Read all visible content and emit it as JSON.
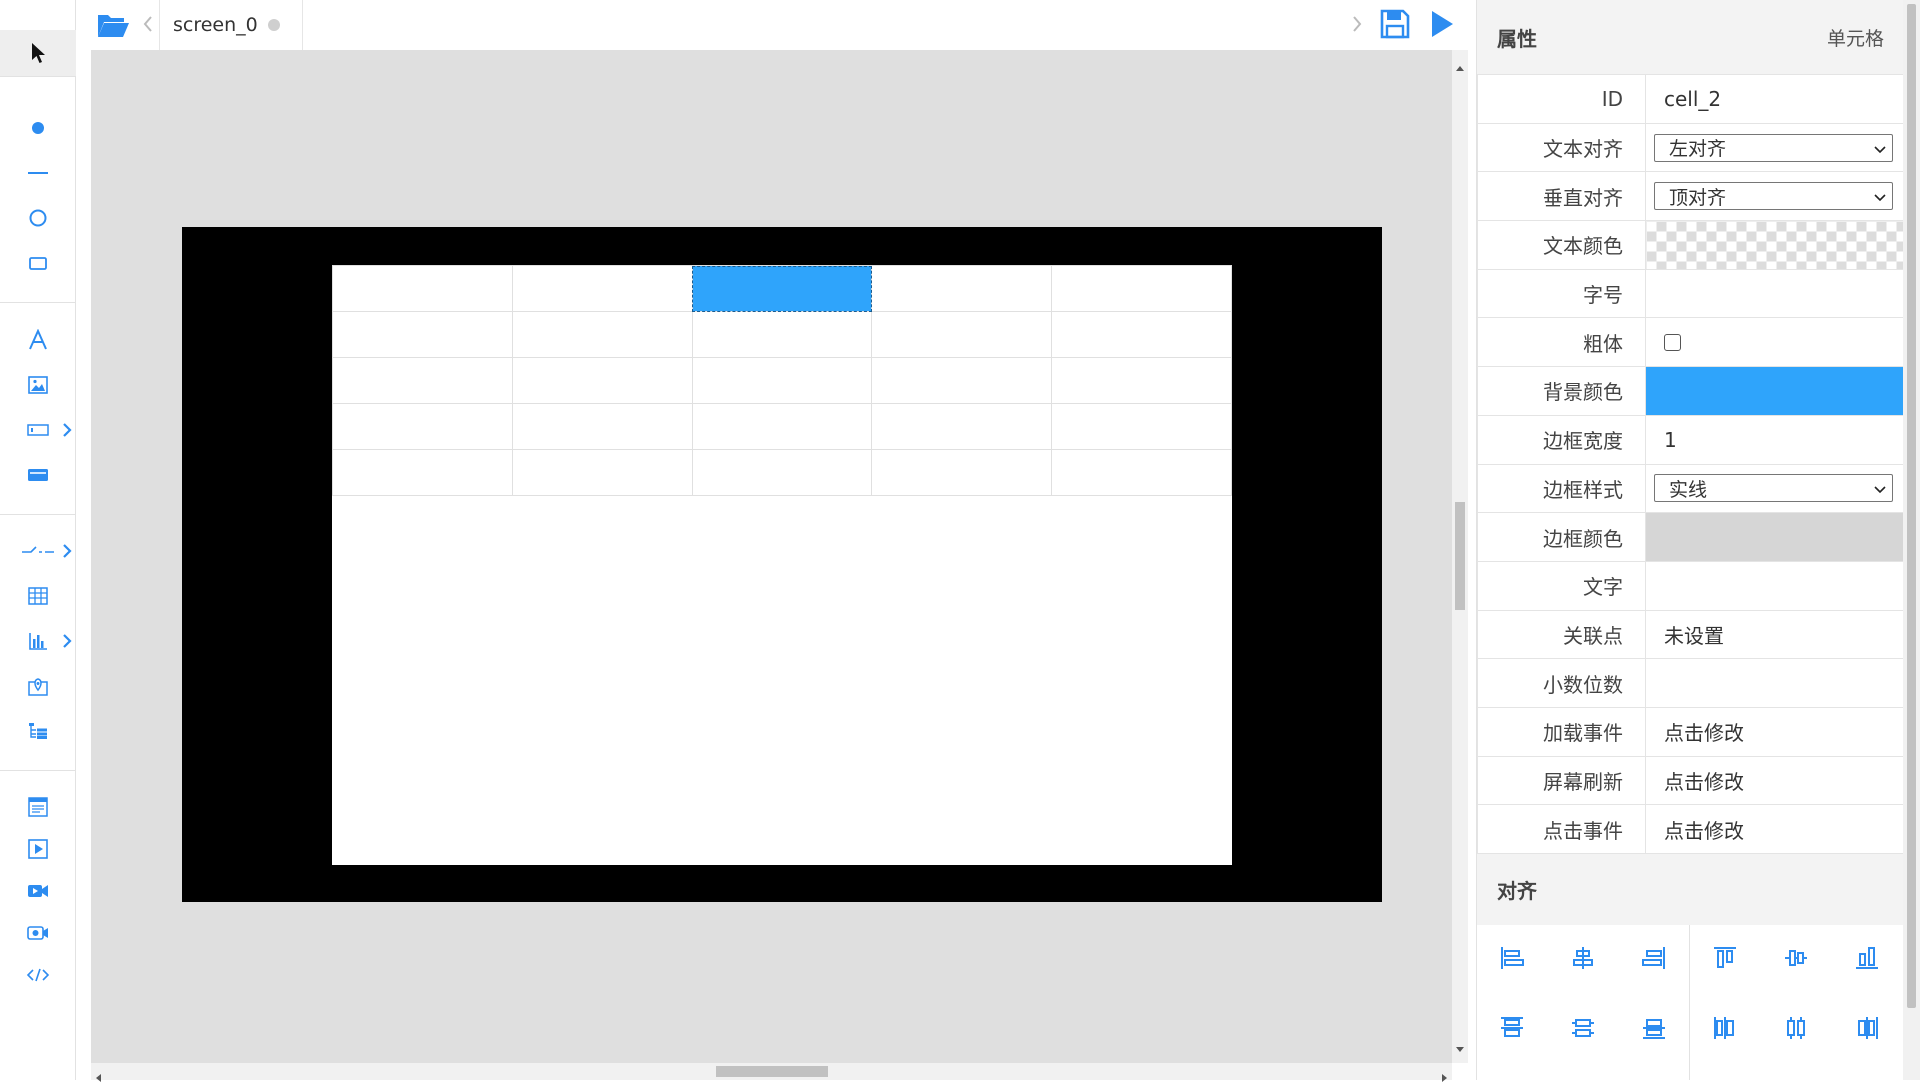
{
  "tab": {
    "name": "screen_0"
  },
  "properties": {
    "title": "属性",
    "object_type": "单元格",
    "rows": {
      "id": {
        "label": "ID",
        "value": "cell_2"
      },
      "text_align": {
        "label": "文本对齐",
        "value": "左对齐"
      },
      "vertical_align": {
        "label": "垂直对齐",
        "value": "顶对齐"
      },
      "text_color": {
        "label": "文本颜色"
      },
      "font_size": {
        "label": "字号",
        "value": ""
      },
      "bold": {
        "label": "粗体",
        "checked": false
      },
      "background_color": {
        "label": "背景颜色",
        "color": "#2fa4fb"
      },
      "border_width": {
        "label": "边框宽度",
        "value": "1"
      },
      "border_style": {
        "label": "边框样式",
        "value": "实线"
      },
      "border_color": {
        "label": "边框颜色",
        "color": "#d6d6d6"
      },
      "text": {
        "label": "文字",
        "value": ""
      },
      "linked_point": {
        "label": "关联点",
        "value": "未设置"
      },
      "decimals": {
        "label": "小数位数",
        "value": ""
      },
      "load_event": {
        "label": "加载事件",
        "value": "点击修改"
      },
      "screen_refresh": {
        "label": "屏幕刷新",
        "value": "点击修改"
      },
      "click_event": {
        "label": "点击事件",
        "value": "点击修改"
      }
    }
  },
  "alignment": {
    "title": "对齐"
  },
  "canvas": {
    "background": "#000000",
    "table": {
      "rows": 5,
      "cols": 5,
      "selected_row": 1,
      "selected_col": 3,
      "selected_color": "#2fa4fb"
    }
  },
  "colors": {
    "accent": "#2d8cf0",
    "workspace": "#dfdfdf"
  },
  "icons": {
    "toolbox": [
      "pointer-icon",
      "dot-icon",
      "line-icon",
      "circle-icon",
      "rectangle-icon",
      "text-icon",
      "image-icon",
      "input-icon",
      "button-icon",
      "switch-icon",
      "table-icon",
      "chart-icon",
      "map-pin-icon",
      "tree-icon",
      "form-icon",
      "media-icon",
      "video-icon",
      "camera-icon",
      "code-icon"
    ]
  }
}
